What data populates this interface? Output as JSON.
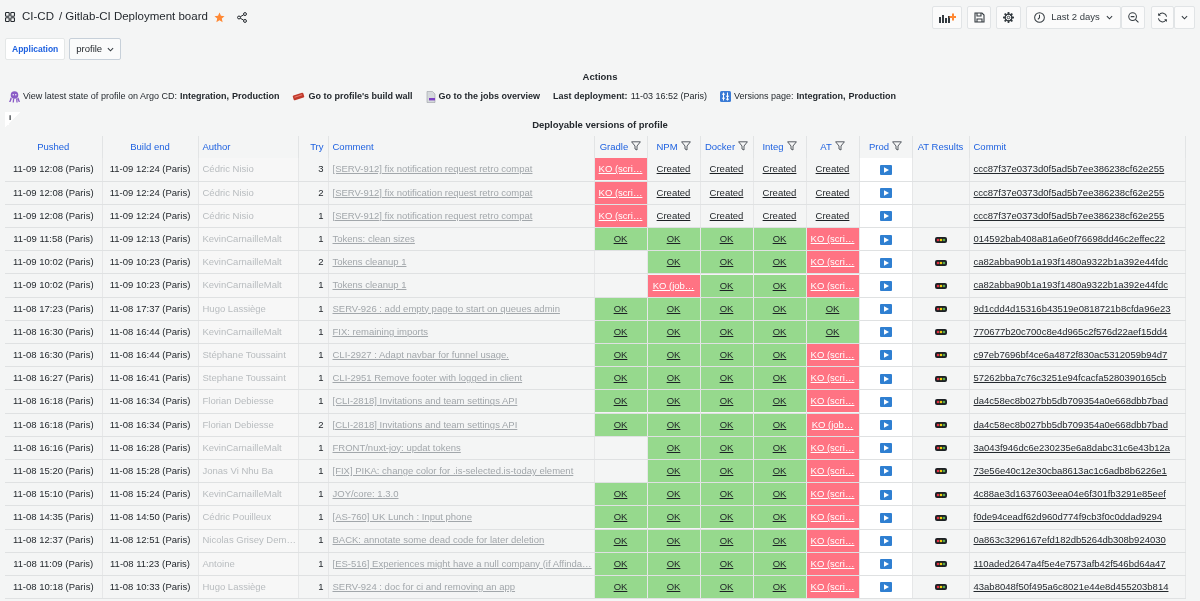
{
  "header": {
    "folder": "CI-CD",
    "title": "/ Gitlab-CI Deployment board",
    "starred": true
  },
  "toolbar": {
    "time_range": "Last 2 days"
  },
  "variables": [
    {
      "label": "Application",
      "value": "profile"
    }
  ],
  "actions_panel": {
    "title": "Actions",
    "items": [
      {
        "kind": "links",
        "label": "View latest state of profile on Argo CD:",
        "links": [
          "Integration,",
          "Production"
        ]
      },
      {
        "kind": "link",
        "label": "Go to profile's build wall"
      },
      {
        "kind": "link",
        "label": "Go to the jobs overview"
      },
      {
        "kind": "fact",
        "label": "Last deployment:",
        "value": "11-03 16:52 (Paris)"
      },
      {
        "kind": "links",
        "label": "Versions page:",
        "links": [
          "Integration,",
          "Production"
        ]
      }
    ]
  },
  "table_panel": {
    "info": "i",
    "title": "Deployable versions of profile",
    "columns": [
      {
        "label": "Pushed",
        "filter": false
      },
      {
        "label": "Build end",
        "filter": false
      },
      {
        "label": "Author",
        "filter": false
      },
      {
        "label": "Try",
        "filter": false
      },
      {
        "label": "Comment",
        "filter": false
      },
      {
        "label": "Gradle",
        "filter": true
      },
      {
        "label": "NPM",
        "filter": true
      },
      {
        "label": "Docker",
        "filter": true
      },
      {
        "label": "Integ",
        "filter": true
      },
      {
        "label": "AT",
        "filter": true
      },
      {
        "label": "Prod",
        "filter": true
      },
      {
        "label": "AT Results",
        "filter": false
      },
      {
        "label": "Commit",
        "filter": false
      }
    ],
    "rows": [
      {
        "pushed": "11-09 12:08 (Paris)",
        "build_end": "11-09 12:24 (Paris)",
        "author": "Cédric Nisio",
        "try": "3",
        "comment": "[SERV-912] fix notification request retro compat",
        "gradle": {
          "text": "KO (scri…",
          "failed": true,
          "color": "#ff7383"
        },
        "npm": {
          "text": "Created",
          "failed": false
        },
        "docker": {
          "text": "Created",
          "failed": false
        },
        "integ": {
          "text": "Created",
          "failed": false
        },
        "at": {
          "text": "Created",
          "failed": false
        },
        "at_results": false,
        "commit": "ccc87f37e0373d0f5ad5b7ee386238cf62e255"
      },
      {
        "pushed": "11-09 12:08 (Paris)",
        "build_end": "11-09 12:24 (Paris)",
        "author": "Cédric Nisio",
        "try": "2",
        "comment": "[SERV-912] fix notification request retro compat",
        "gradle": {
          "text": "KO (scri…",
          "failed": true,
          "color": "#ff7383"
        },
        "npm": {
          "text": "Created",
          "failed": false
        },
        "docker": {
          "text": "Created",
          "failed": false
        },
        "integ": {
          "text": "Created",
          "failed": false
        },
        "at": {
          "text": "Created",
          "failed": false
        },
        "at_results": false,
        "commit": "ccc87f37e0373d0f5ad5b7ee386238cf62e255"
      },
      {
        "pushed": "11-09 12:08 (Paris)",
        "build_end": "11-09 12:24 (Paris)",
        "author": "Cédric Nisio",
        "try": "1",
        "comment": "[SERV-912] fix notification request retro compat",
        "gradle": {
          "text": "KO (scri…",
          "failed": true,
          "color": "#ff7383"
        },
        "npm": {
          "text": "Created",
          "failed": false
        },
        "docker": {
          "text": "Created",
          "failed": false
        },
        "integ": {
          "text": "Created",
          "failed": false
        },
        "at": {
          "text": "Created",
          "failed": false
        },
        "at_results": false,
        "commit": "ccc87f37e0373d0f5ad5b7ee386238cf62e255"
      },
      {
        "pushed": "11-09 11:58 (Paris)",
        "build_end": "11-09 12:13 (Paris)",
        "author": "KevinCarnailleMalt",
        "try": "1",
        "comment": "Tokens: clean sizes",
        "gradle": {
          "text": "OK",
          "failed": false,
          "color": "#96d98d"
        },
        "npm": {
          "text": "OK",
          "failed": false,
          "color": "#96d98d"
        },
        "docker": {
          "text": "OK",
          "failed": false,
          "color": "#96d98d"
        },
        "integ": {
          "text": "OK",
          "failed": false,
          "color": "#96d98d"
        },
        "at": {
          "text": "KO (scri…",
          "failed": true,
          "color": "#ff7383"
        },
        "at_results": true,
        "commit": "014592bab408a81a6e0f76698dd46c2effec22"
      },
      {
        "pushed": "11-09 10:02 (Paris)",
        "build_end": "11-09 10:23 (Paris)",
        "author": "KevinCarnailleMalt",
        "try": "2",
        "comment": "Tokens cleanup 1",
        "npm": {
          "text": "OK",
          "failed": false,
          "color": "#96d98d"
        },
        "docker": {
          "text": "OK",
          "failed": false,
          "color": "#96d98d"
        },
        "integ": {
          "text": "OK",
          "failed": false,
          "color": "#96d98d"
        },
        "at": {
          "text": "KO (scri…",
          "failed": true,
          "color": "#ff7383"
        },
        "at_results": true,
        "commit": "ca82abba90b1a193f1480a9322b1a392e44fdc"
      },
      {
        "pushed": "11-09 10:02 (Paris)",
        "build_end": "11-09 10:23 (Paris)",
        "author": "KevinCarnailleMalt",
        "try": "1",
        "comment": "Tokens cleanup 1",
        "npm": {
          "text": "KO (job…",
          "failed": true,
          "color": "#ff7383"
        },
        "docker": {
          "text": "OK",
          "failed": false,
          "color": "#96d98d"
        },
        "integ": {
          "text": "OK",
          "failed": false,
          "color": "#96d98d"
        },
        "at": {
          "text": "KO (scri…",
          "failed": true,
          "color": "#ff7383"
        },
        "at_results": true,
        "commit": "ca82abba90b1a193f1480a9322b1a392e44fdc"
      },
      {
        "pushed": "11-08 17:23 (Paris)",
        "build_end": "11-08 17:37 (Paris)",
        "author": "Hugo Lassiège",
        "try": "1",
        "comment": "SERV-926 : add empty page to start on queues admin",
        "gradle": {
          "text": "OK",
          "failed": false,
          "color": "#96d98d"
        },
        "npm": {
          "text": "OK",
          "failed": false,
          "color": "#96d98d"
        },
        "docker": {
          "text": "OK",
          "failed": false,
          "color": "#96d98d"
        },
        "integ": {
          "text": "OK",
          "failed": false,
          "color": "#96d98d"
        },
        "at": {
          "text": "OK",
          "failed": false,
          "color": "#96d98d"
        },
        "at_results": true,
        "commit": "9d1cdd4d15316b43519e0818721b8cfda96e23"
      },
      {
        "pushed": "11-08 16:30 (Paris)",
        "build_end": "11-08 16:44 (Paris)",
        "author": "KevinCarnailleMalt",
        "try": "1",
        "comment": "FIX: remaining imports",
        "gradle": {
          "text": "OK",
          "failed": false,
          "color": "#96d98d"
        },
        "npm": {
          "text": "OK",
          "failed": false,
          "color": "#96d98d"
        },
        "docker": {
          "text": "OK",
          "failed": false,
          "color": "#96d98d"
        },
        "integ": {
          "text": "OK",
          "failed": false,
          "color": "#96d98d"
        },
        "at": {
          "text": "OK",
          "failed": false,
          "color": "#96d98d"
        },
        "at_results": true,
        "commit": "770677b20c700c8e4d965c2f576d22aef15dd4"
      },
      {
        "pushed": "11-08 16:30 (Paris)",
        "build_end": "11-08 16:44 (Paris)",
        "author": "Stéphane Toussaint",
        "try": "1",
        "comment": "CLI-2927 : Adapt navbar for funnel usage.",
        "gradle": {
          "text": "OK",
          "failed": false,
          "color": "#96d98d"
        },
        "npm": {
          "text": "OK",
          "failed": false,
          "color": "#96d98d"
        },
        "docker": {
          "text": "OK",
          "failed": false,
          "color": "#96d98d"
        },
        "integ": {
          "text": "OK",
          "failed": false,
          "color": "#96d98d"
        },
        "at": {
          "text": "KO (scri…",
          "failed": true,
          "color": "#ff7383"
        },
        "at_results": true,
        "commit": "c97eb7696bf4ce6a4872f830ac5312059b94d7"
      },
      {
        "pushed": "11-08 16:27 (Paris)",
        "build_end": "11-08 16:41 (Paris)",
        "author": "Stephane Toussaint",
        "try": "1",
        "comment": "CLI-2951 Remove footer with logged in client",
        "gradle": {
          "text": "OK",
          "failed": false,
          "color": "#96d98d"
        },
        "npm": {
          "text": "OK",
          "failed": false,
          "color": "#96d98d"
        },
        "docker": {
          "text": "OK",
          "failed": false,
          "color": "#96d98d"
        },
        "integ": {
          "text": "OK",
          "failed": false,
          "color": "#96d98d"
        },
        "at": {
          "text": "KO (scri…",
          "failed": true,
          "color": "#ff7383"
        },
        "at_results": true,
        "commit": "57262bba7c76c3251e94fcacfa5280390165cb"
      },
      {
        "pushed": "11-08 16:18 (Paris)",
        "build_end": "11-08 16:34 (Paris)",
        "author": "Florian Debiesse",
        "try": "1",
        "comment": "[CLI-2818] Invitations and team settings API",
        "gradle": {
          "text": "OK",
          "failed": false,
          "color": "#96d98d"
        },
        "npm": {
          "text": "OK",
          "failed": false,
          "color": "#96d98d"
        },
        "docker": {
          "text": "OK",
          "failed": false,
          "color": "#96d98d"
        },
        "integ": {
          "text": "OK",
          "failed": false,
          "color": "#96d98d"
        },
        "at": {
          "text": "KO (scri…",
          "failed": true,
          "color": "#ff7383"
        },
        "at_results": true,
        "commit": "da4c58ec8b027bb5db709354a0e668dbb7bad"
      },
      {
        "pushed": "11-08 16:18 (Paris)",
        "build_end": "11-08 16:34 (Paris)",
        "author": "Florian Debiesse",
        "try": "2",
        "comment": "[CLI-2818] Invitations and team settings API",
        "gradle": {
          "text": "OK",
          "failed": false,
          "color": "#96d98d"
        },
        "npm": {
          "text": "OK",
          "failed": false,
          "color": "#96d98d"
        },
        "docker": {
          "text": "OK",
          "failed": false,
          "color": "#96d98d"
        },
        "integ": {
          "text": "OK",
          "failed": false,
          "color": "#96d98d"
        },
        "at": {
          "text": "KO (job…",
          "failed": true,
          "color": "#ff7383"
        },
        "at_results": true,
        "commit": "da4c58ec8b027bb5db709354a0e668dbb7bad"
      },
      {
        "pushed": "11-08 16:16 (Paris)",
        "build_end": "11-08 16:28 (Paris)",
        "author": "KevinCarnailleMalt",
        "try": "1",
        "comment": "FRONT/nuxt-joy: updat tokens",
        "npm": {
          "text": "OK",
          "failed": false,
          "color": "#96d98d"
        },
        "docker": {
          "text": "OK",
          "failed": false,
          "color": "#96d98d"
        },
        "integ": {
          "text": "OK",
          "failed": false,
          "color": "#96d98d"
        },
        "at": {
          "text": "KO (scri…",
          "failed": true,
          "color": "#ff7383"
        },
        "at_results": true,
        "commit": "3a043f946dc6e230235e6a8dabc31c6e43b12a"
      },
      {
        "pushed": "11-08 15:20 (Paris)",
        "build_end": "11-08 15:28 (Paris)",
        "author": "Jonas Vi Nhu Ba",
        "try": "1",
        "comment": "[FIX] PIKA: change color for .is-selected.is-today element",
        "npm": {
          "text": "OK",
          "failed": false,
          "color": "#96d98d"
        },
        "docker": {
          "text": "OK",
          "failed": false,
          "color": "#96d98d"
        },
        "integ": {
          "text": "OK",
          "failed": false,
          "color": "#96d98d"
        },
        "at": {
          "text": "KO (scri…",
          "failed": true,
          "color": "#ff7383"
        },
        "at_results": true,
        "commit": "73e56e40c12e30cba8613ac1c6adb8b6226e1"
      },
      {
        "pushed": "11-08 15:10 (Paris)",
        "build_end": "11-08 15:24 (Paris)",
        "author": "KevinCarnailleMalt",
        "try": "1",
        "comment": "JOY/core: 1.3.0",
        "gradle": {
          "text": "OK",
          "failed": false,
          "color": "#96d98d"
        },
        "npm": {
          "text": "OK",
          "failed": false,
          "color": "#96d98d"
        },
        "docker": {
          "text": "OK",
          "failed": false,
          "color": "#96d98d"
        },
        "integ": {
          "text": "OK",
          "failed": false,
          "color": "#96d98d"
        },
        "at": {
          "text": "KO (scri…",
          "failed": true,
          "color": "#ff7383"
        },
        "at_results": true,
        "commit": "4c88ae3d1637603eea04e6f301fb3291e85eef"
      },
      {
        "pushed": "11-08 14:35 (Paris)",
        "build_end": "11-08 14:50 (Paris)",
        "author": "Cédric Pouilleux",
        "try": "1",
        "comment": "[AS-760] UK Lunch : Input phone",
        "gradle": {
          "text": "OK",
          "failed": false,
          "color": "#96d98d"
        },
        "npm": {
          "text": "OK",
          "failed": false,
          "color": "#96d98d"
        },
        "docker": {
          "text": "OK",
          "failed": false,
          "color": "#96d98d"
        },
        "integ": {
          "text": "OK",
          "failed": false,
          "color": "#96d98d"
        },
        "at": {
          "text": "KO (scri…",
          "failed": true,
          "color": "#ff7383"
        },
        "at_results": true,
        "commit": "f0de94ceadf62d960d774f9cb3f0c0ddad9294"
      },
      {
        "pushed": "11-08 12:37 (Paris)",
        "build_end": "11-08 12:51 (Paris)",
        "author": "Nicolas Grisey Dem…",
        "try": "1",
        "comment": "BACK: annotate some dead code for later deletion",
        "gradle": {
          "text": "OK",
          "failed": false,
          "color": "#96d98d"
        },
        "npm": {
          "text": "OK",
          "failed": false,
          "color": "#96d98d"
        },
        "docker": {
          "text": "OK",
          "failed": false,
          "color": "#96d98d"
        },
        "integ": {
          "text": "OK",
          "failed": false,
          "color": "#96d98d"
        },
        "at": {
          "text": "KO (scri…",
          "failed": true,
          "color": "#ff7383"
        },
        "at_results": true,
        "commit": "0a863c3296167efd182db5264db308b924030"
      },
      {
        "pushed": "11-08 11:09 (Paris)",
        "build_end": "11-08 11:23 (Paris)",
        "author": "Antoine",
        "try": "1",
        "comment": "[ES-516] Experiences might have a null company (if Affinda…",
        "gradle": {
          "text": "OK",
          "failed": false,
          "color": "#96d98d"
        },
        "npm": {
          "text": "OK",
          "failed": false,
          "color": "#96d98d"
        },
        "docker": {
          "text": "OK",
          "failed": false,
          "color": "#96d98d"
        },
        "integ": {
          "text": "OK",
          "failed": false,
          "color": "#96d98d"
        },
        "at": {
          "text": "KO (scri…",
          "failed": true,
          "color": "#ff7383"
        },
        "at_results": true,
        "commit": "110aded2647a4f5e4e7573afb42f546bd64a47"
      },
      {
        "pushed": "11-08 10:18 (Paris)",
        "build_end": "11-08 10:33 (Paris)",
        "author": "Hugo Lassiège",
        "try": "1",
        "comment": "SERV-924 : doc for ci and removing an app",
        "gradle": {
          "text": "OK",
          "failed": false,
          "color": "#96d98d"
        },
        "npm": {
          "text": "OK",
          "failed": false,
          "color": "#96d98d"
        },
        "docker": {
          "text": "OK",
          "failed": false,
          "color": "#96d98d"
        },
        "integ": {
          "text": "OK",
          "failed": false,
          "color": "#96d98d"
        },
        "at": {
          "text": "KO (scri…",
          "failed": true,
          "color": "#ff7383"
        },
        "at_results": true,
        "commit": "43ab8048f50f495a6c8021e44e8d455203b814"
      }
    ]
  }
}
